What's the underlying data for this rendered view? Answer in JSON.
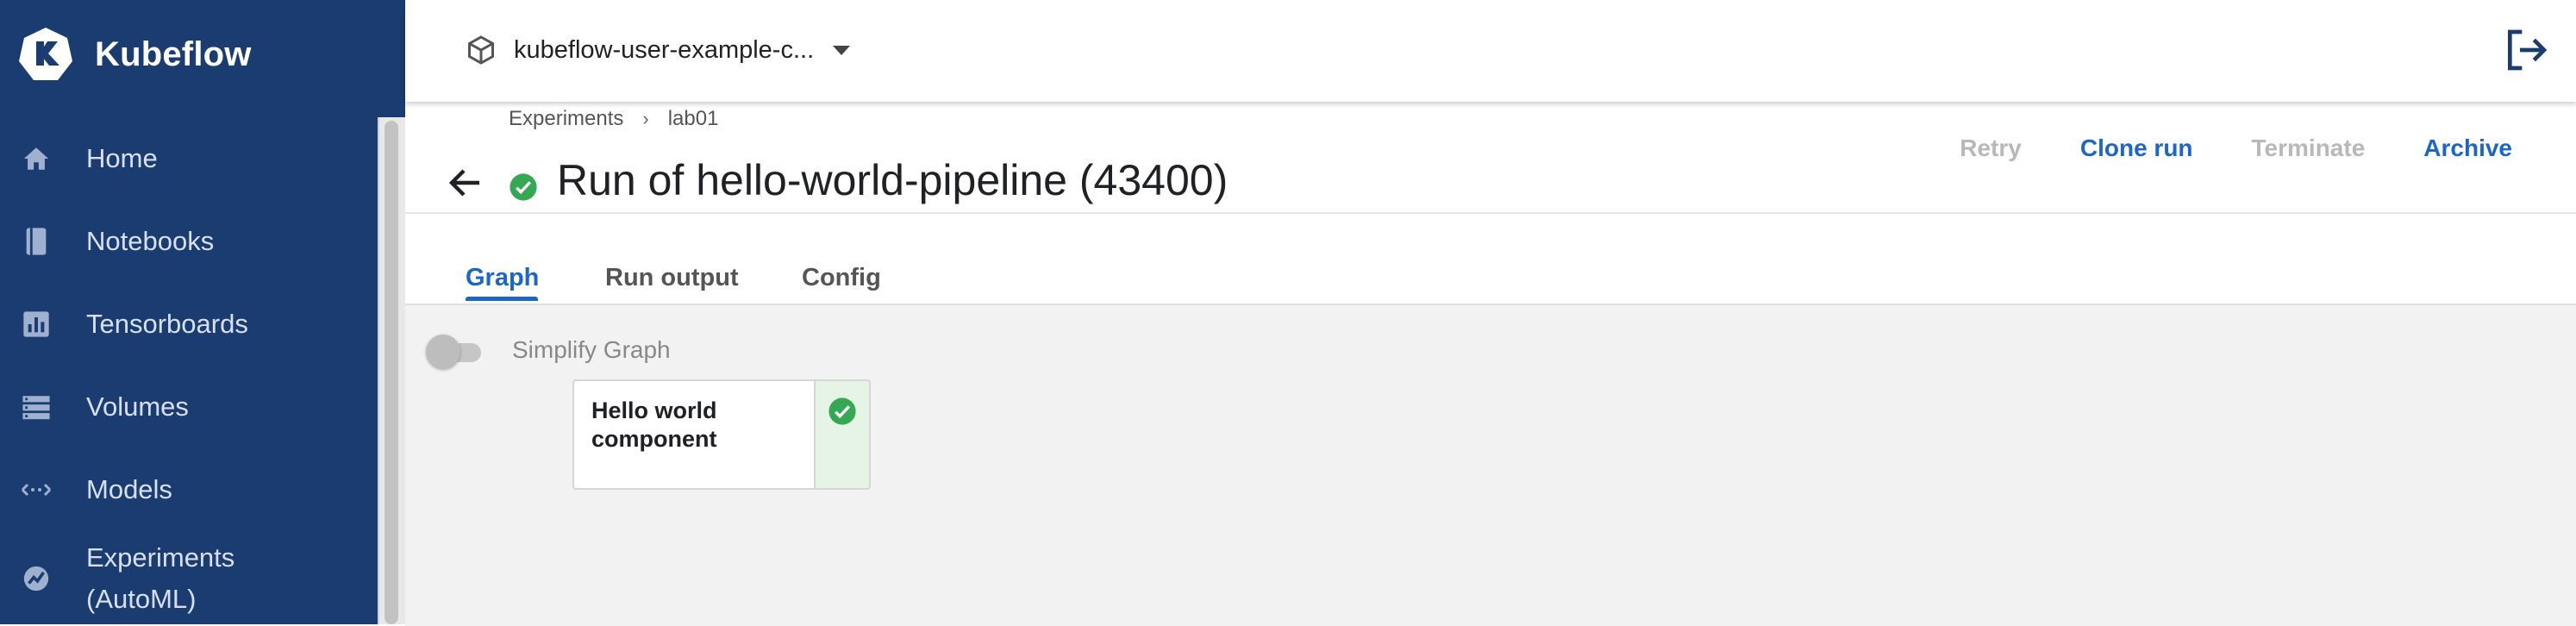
{
  "sidebar": {
    "app_title": "Kubeflow",
    "items": [
      {
        "label": "Home",
        "icon": "home-icon"
      },
      {
        "label": "Notebooks",
        "icon": "book-icon"
      },
      {
        "label": "Tensorboards",
        "icon": "bar-chart-icon"
      },
      {
        "label": "Volumes",
        "icon": "storage-icon"
      },
      {
        "label": "Models",
        "icon": "arrows-icon"
      },
      {
        "label": "Experiments\n(AutoML)",
        "icon": "automl-icon"
      }
    ]
  },
  "topbar": {
    "namespace": "kubeflow-user-example-c...",
    "namespace_icon": "cube-icon",
    "logout_icon": "logout-icon"
  },
  "run": {
    "breadcrumb": [
      "Experiments",
      "lab01"
    ],
    "breadcrumb_separator": "›",
    "title": "Run of hello-world-pipeline (43400)",
    "status": "succeeded",
    "actions": {
      "retry": "Retry",
      "clone": "Clone run",
      "terminate": "Terminate",
      "archive": "Archive"
    }
  },
  "tabs": [
    "Graph",
    "Run output",
    "Config"
  ],
  "active_tab": "Graph",
  "graph": {
    "simplify_label": "Simplify Graph",
    "simplify_enabled": false,
    "nodes": [
      {
        "label": "Hello world component",
        "status": "succeeded"
      }
    ]
  },
  "colors": {
    "sidebar_bg": "#1a3c70",
    "accent": "#1a66c9",
    "success": "#34a853",
    "canvas_bg": "#f2f2f2"
  }
}
